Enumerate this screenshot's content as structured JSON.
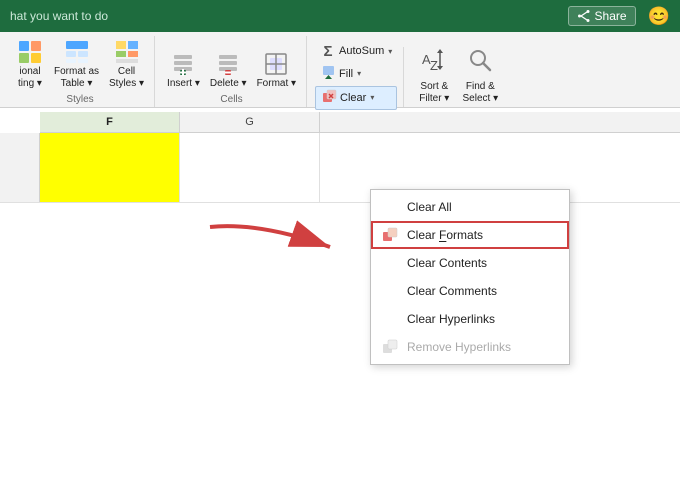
{
  "topbar": {
    "search_text": "hat you want to do",
    "share_label": "Share",
    "smiley": "😊"
  },
  "ribbon": {
    "groups": [
      {
        "name": "styles",
        "label": "Styles",
        "buttons": [
          {
            "id": "conditional",
            "label": "ional\nting",
            "icon": "▤"
          },
          {
            "id": "format-as-table",
            "label": "Format as\nTable",
            "icon": "⊞"
          },
          {
            "id": "cell-styles",
            "label": "Cell\nStyles",
            "icon": "▦"
          }
        ]
      },
      {
        "name": "cells",
        "label": "Cells",
        "buttons": [
          {
            "id": "insert",
            "label": "Insert",
            "icon": "⊕"
          },
          {
            "id": "delete",
            "label": "Delete",
            "icon": "⊖"
          },
          {
            "id": "format",
            "label": "Format",
            "icon": "⊟"
          }
        ]
      },
      {
        "name": "editing",
        "label": "",
        "buttons": [
          {
            "id": "autosum",
            "label": "AutoSum",
            "icon": "Σ",
            "arrow": true
          },
          {
            "id": "fill",
            "label": "Fill",
            "icon": "⬇",
            "arrow": true
          },
          {
            "id": "clear",
            "label": "Clear",
            "icon": "🧹",
            "arrow": true,
            "active": true
          }
        ]
      },
      {
        "name": "sort-filter",
        "label": "",
        "buttons": [
          {
            "id": "sort-filter",
            "label": "Sort &\nFilter",
            "icon": "⇅▽"
          },
          {
            "id": "find-select",
            "label": "Find &\nSelect",
            "icon": "🔍"
          }
        ]
      }
    ],
    "clear_dropdown": {
      "items": [
        {
          "id": "clear-all",
          "label": "Clear All",
          "icon": "",
          "disabled": false
        },
        {
          "id": "clear-formats",
          "label": "Clear Formats",
          "icon": "%",
          "disabled": false,
          "highlighted": true
        },
        {
          "id": "clear-contents",
          "label": "Clear Contents",
          "icon": "",
          "disabled": false
        },
        {
          "id": "clear-comments",
          "label": "Clear Comments",
          "icon": "",
          "disabled": false
        },
        {
          "id": "clear-hyperlinks",
          "label": "Clear Hyperlinks",
          "icon": "",
          "disabled": false
        },
        {
          "id": "remove-hyperlinks",
          "label": "Remove Hyperlinks",
          "icon": "%",
          "disabled": true
        }
      ]
    }
  },
  "spreadsheet": {
    "col_headers": [
      "F",
      "G"
    ],
    "rows": [
      {
        "num": "",
        "cells": [
          "yellow",
          "normal"
        ]
      }
    ]
  }
}
